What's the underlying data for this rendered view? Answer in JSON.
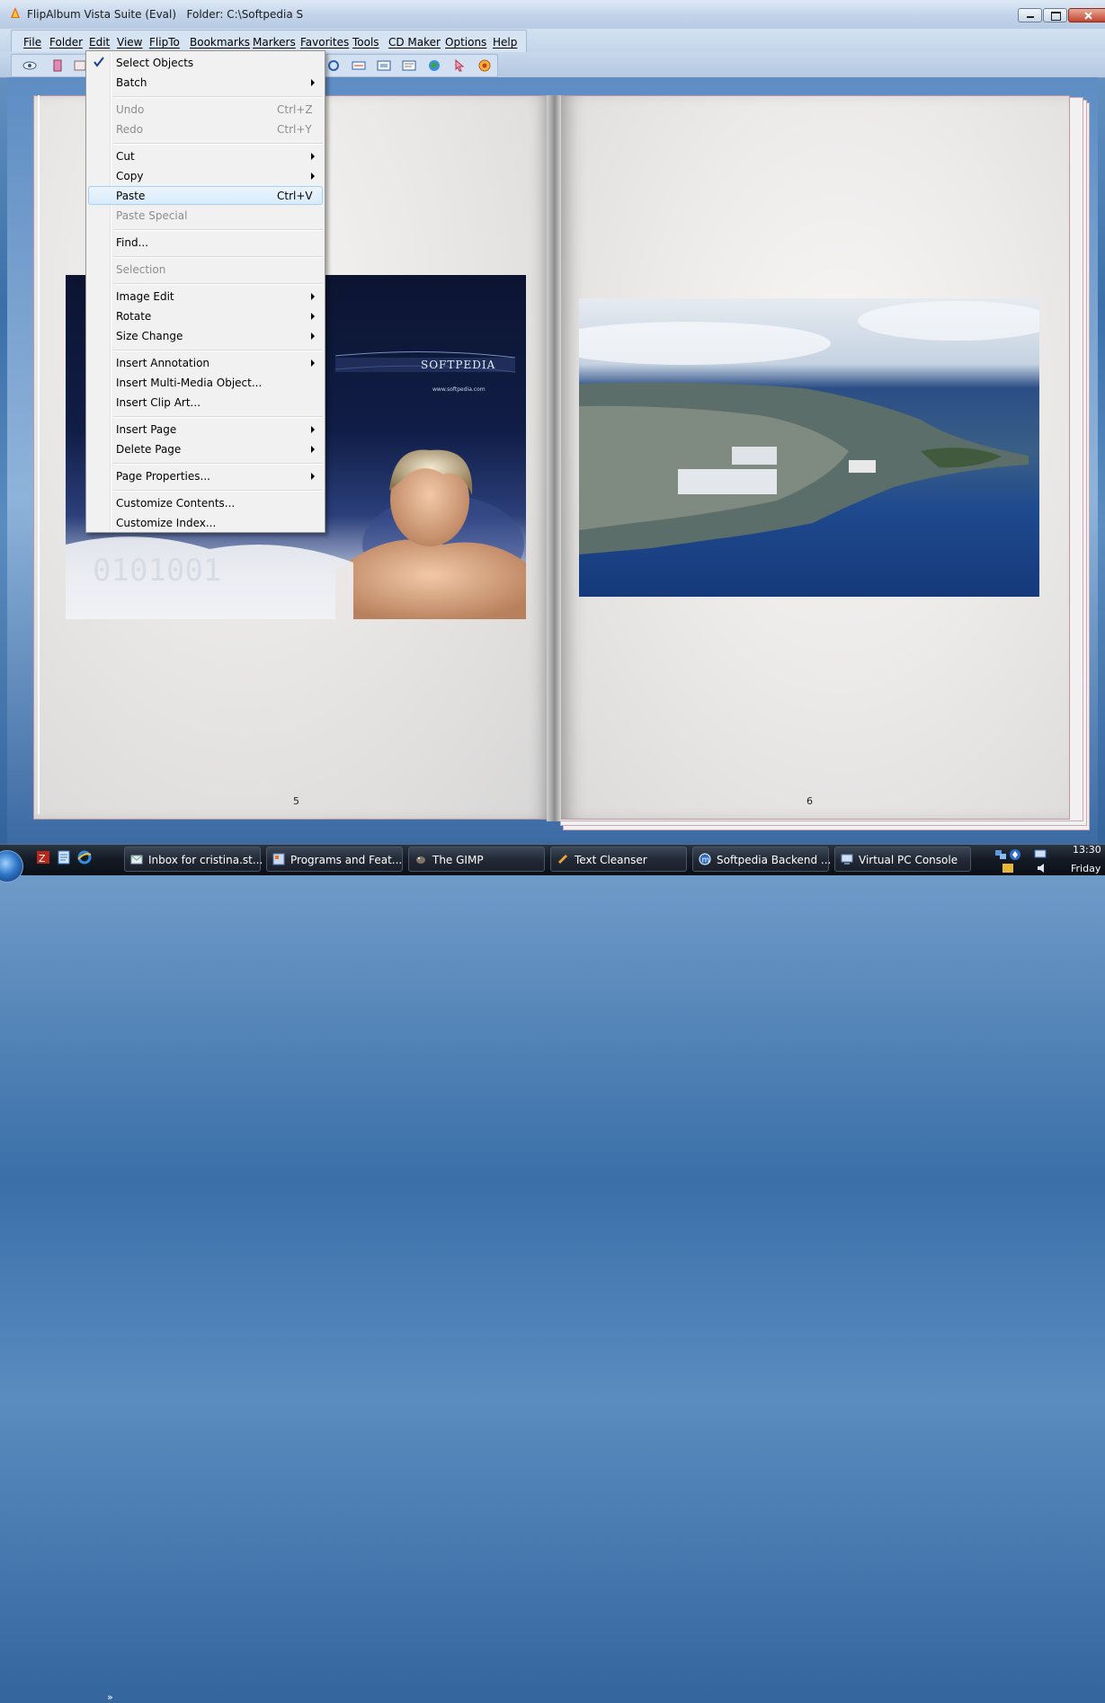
{
  "window": {
    "title": "FlipAlbum Vista Suite (Eval)   Folder: C:\\Softpedia S"
  },
  "menubar": {
    "items": [
      "File",
      "Folder",
      "Edit",
      "View",
      "FlipTo",
      "Bookmarks",
      "Markers",
      "Favorites",
      "Tools",
      "CD Maker",
      "Options",
      "Help"
    ]
  },
  "edit_menu": {
    "items": [
      {
        "label": "Select Objects",
        "checked": true
      },
      {
        "label": "Batch",
        "submenu": true
      },
      {
        "label": "Undo",
        "shortcut": "Ctrl+Z",
        "disabled": true
      },
      {
        "label": "Redo",
        "shortcut": "Ctrl+Y",
        "disabled": true
      },
      {
        "label": "Cut",
        "submenu": true
      },
      {
        "label": "Copy",
        "submenu": true
      },
      {
        "label": "Paste",
        "shortcut": "Ctrl+V",
        "highlighted": true
      },
      {
        "label": "Paste Special",
        "disabled": true
      },
      {
        "label": "Find..."
      },
      {
        "label": "Selection",
        "disabled": true
      },
      {
        "label": "Image Edit",
        "submenu": true
      },
      {
        "label": "Rotate",
        "submenu": true
      },
      {
        "label": "Size Change",
        "submenu": true
      },
      {
        "label": "Insert Annotation",
        "submenu": true
      },
      {
        "label": "Insert Multi-Media Object..."
      },
      {
        "label": "Insert Clip Art..."
      },
      {
        "label": "Insert Page",
        "submenu": true
      },
      {
        "label": "Delete Page",
        "submenu": true
      },
      {
        "label": "Page Properties...",
        "submenu": true
      },
      {
        "label": "Customize Contents..."
      },
      {
        "label": "Customize Index..."
      }
    ]
  },
  "book": {
    "left_page_number": "5",
    "right_page_number": "6",
    "left_photo_text": "SOFTPEDIA",
    "left_photo_url": "www.softpedia.com"
  },
  "taskbar": {
    "more": "»",
    "tasks": [
      "Inbox for cristina.st...",
      "Programs and Feat...",
      "The GIMP",
      "Text Cleanser",
      "Softpedia Backend ...",
      "Virtual PC Console"
    ],
    "clock_time": "13:30",
    "clock_day": "Friday"
  },
  "colors": {
    "menu_highlight": "#d9ecfb",
    "title_bar": "#c4d5ea",
    "taskbar": "#151c26"
  }
}
